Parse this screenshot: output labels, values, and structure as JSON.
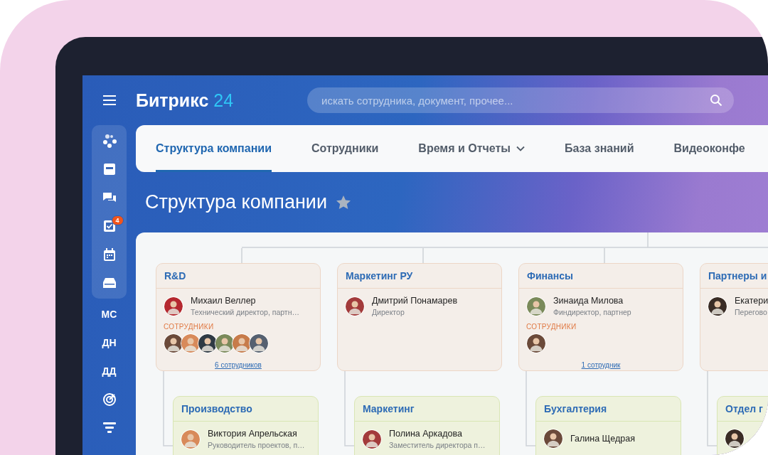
{
  "logo": {
    "text": "Битрикс",
    "accent": "24"
  },
  "search": {
    "placeholder": "искать сотрудника, документ, прочее..."
  },
  "sidebar": {
    "tasks_badge": "4",
    "items": [
      {
        "kind": "initials",
        "label": "МС"
      },
      {
        "kind": "initials",
        "label": "ДН"
      },
      {
        "kind": "initials",
        "label": "ДД"
      },
      {
        "kind": "icon"
      },
      {
        "kind": "icon"
      }
    ]
  },
  "tabs": [
    {
      "label": "Структура компании",
      "selected": true,
      "dropdown": false
    },
    {
      "label": "Сотрудники",
      "selected": false,
      "dropdown": false
    },
    {
      "label": "Время и Отчеты",
      "selected": false,
      "dropdown": true
    },
    {
      "label": "База знаний",
      "selected": false,
      "dropdown": false
    },
    {
      "label": "Видеоконфе",
      "selected": false,
      "dropdown": false
    }
  ],
  "page_title": "Структура компании",
  "departments": [
    {
      "name": "R&D",
      "head": {
        "name": "Михаил Веллер",
        "position": "Технический директор, партн…"
      },
      "staff_label": "СОТРУДНИКИ",
      "staff": [
        {
          "kind": "avatar"
        },
        {
          "kind": "avatar"
        },
        {
          "kind": "avatar"
        },
        {
          "kind": "avatar"
        },
        {
          "kind": "avatar"
        },
        {
          "kind": "avatar"
        }
      ],
      "staff_link": "6 сотрудников",
      "children": [
        {
          "name": "Производство",
          "head": {
            "name": "Виктория Апрельская",
            "position": "Руководитель проектов, п…"
          }
        }
      ]
    },
    {
      "name": "Маркетинг РУ",
      "head": {
        "name": "Дмитрий Понамарев",
        "position": "Директор"
      },
      "children": [
        {
          "name": "Маркетинг",
          "head": {
            "name": "Полина Аркадова",
            "position": "Заместитель директора п…"
          }
        }
      ]
    },
    {
      "name": "Финансы",
      "head": {
        "name": "Зинаида Милова",
        "position": "Финдиректор, партнер"
      },
      "staff_label": "СОТРУДНИКИ",
      "staff": [
        {
          "kind": "avatar"
        }
      ],
      "staff_link": "1 сотрудник",
      "children": [
        {
          "name": "Бухгалтерия",
          "head": {
            "name": "Галина Щедрая"
          }
        }
      ]
    },
    {
      "name": "Партнеры и",
      "head": {
        "name": "Екатери",
        "position": "Перегово"
      },
      "children": [
        {
          "name": "Отдел г",
          "head": {
            "avatar": true
          }
        }
      ]
    }
  ]
}
